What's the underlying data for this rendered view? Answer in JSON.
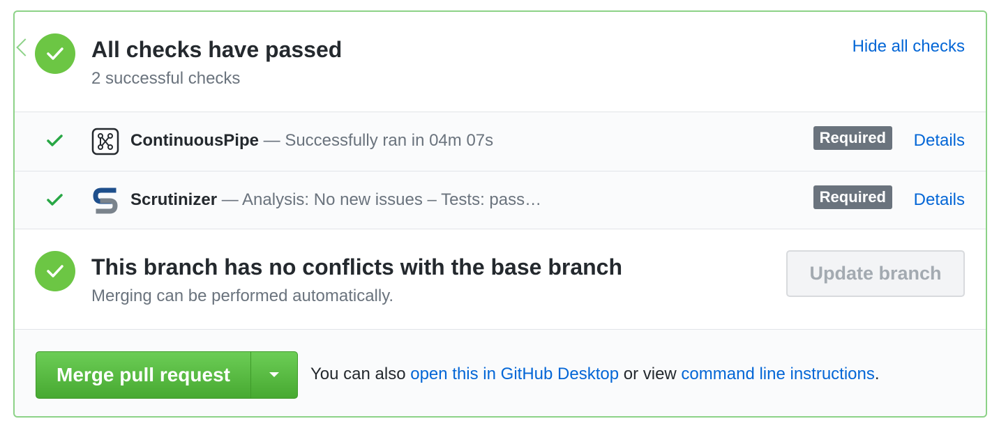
{
  "status": {
    "title": "All checks have passed",
    "subtitle": "2 successful checks",
    "toggle_label": "Hide all checks"
  },
  "checks": [
    {
      "name": "ContinuousPipe",
      "separator": " — ",
      "description": "Successfully ran in 04m 07s",
      "badge": "Required",
      "details_label": "Details",
      "logo_icon": "continuouspipe-logo-icon"
    },
    {
      "name": "Scrutinizer",
      "separator": " — ",
      "description": "Analysis: No new issues – Tests: pass…",
      "badge": "Required",
      "details_label": "Details",
      "logo_icon": "scrutinizer-logo-icon"
    }
  ],
  "branch": {
    "title": "This branch has no conflicts with the base branch",
    "subtitle": "Merging can be performed automatically.",
    "update_button": "Update branch"
  },
  "merge": {
    "button_label": "Merge pull request",
    "note_prefix": "You can also ",
    "desktop_link": "open this in GitHub Desktop",
    "note_middle": " or view ",
    "cli_link": "command line instructions",
    "note_suffix": "."
  },
  "colors": {
    "success": "#6cc644",
    "border": "#8cd287",
    "link": "#0366d6",
    "badge": "#6a737d"
  }
}
